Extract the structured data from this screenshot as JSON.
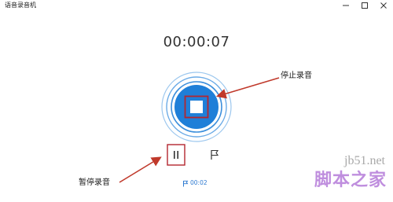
{
  "window": {
    "title": "语音录音机"
  },
  "recorder": {
    "elapsed_time": "00:00:07",
    "marker_time": "00:02"
  },
  "annotations": {
    "stop_label": "停止录音",
    "pause_label": "暂停录音"
  },
  "watermark": {
    "site": "jb51.net",
    "name": "脚本之家"
  },
  "icons": {
    "stop": "stop-icon",
    "pause": "pause-icon",
    "flag": "flag-icon",
    "minimize": "minimize-icon",
    "maximize": "maximize-icon",
    "close": "close-icon"
  },
  "colors": {
    "accent": "#1f7fd8",
    "accent_ring": "#2b86da",
    "annotation": "#c0392b",
    "watermark_name": "#a55fd1"
  }
}
